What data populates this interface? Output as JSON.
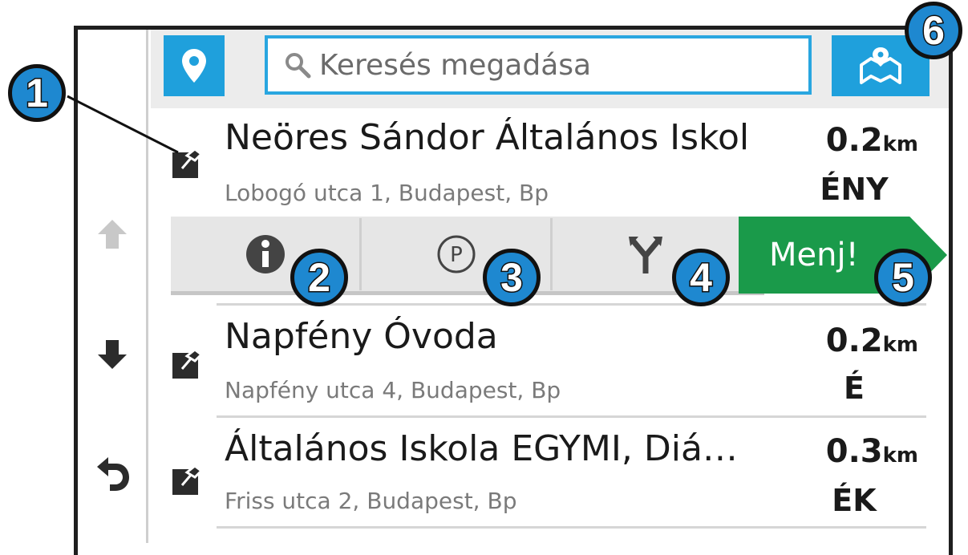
{
  "search": {
    "placeholder": "Keresés megadása"
  },
  "results": [
    {
      "name": "Neöres Sándor Általános Iskol",
      "address": "Lobogó utca 1, Budapest, Bp",
      "distance": "0.2",
      "unit": "km",
      "direction": "ÉNY"
    },
    {
      "name": "Napfény Óvoda",
      "address": "Napfény utca 4, Budapest, Bp",
      "distance": "0.2",
      "unit": "km",
      "direction": "É"
    },
    {
      "name": "Általános Iskola EGYMI, Diá…",
      "address": "Friss utca 2, Budapest, Bp",
      "distance": "0.3",
      "unit": "km",
      "direction": "ÉK"
    }
  ],
  "actions": {
    "go_label": "Menj!"
  },
  "callouts": [
    "1",
    "2",
    "3",
    "4",
    "5",
    "6"
  ],
  "colors": {
    "accent_blue": "#1fa0dc",
    "go_green": "#1a9a4a",
    "callout_blue": "#1e88d0"
  },
  "icons": [
    "location-pin-icon",
    "search-icon",
    "map-icon",
    "arrow-up-icon",
    "arrow-down-icon",
    "back-icon",
    "poi-category-icon",
    "info-icon",
    "parking-icon",
    "route-fork-icon"
  ]
}
